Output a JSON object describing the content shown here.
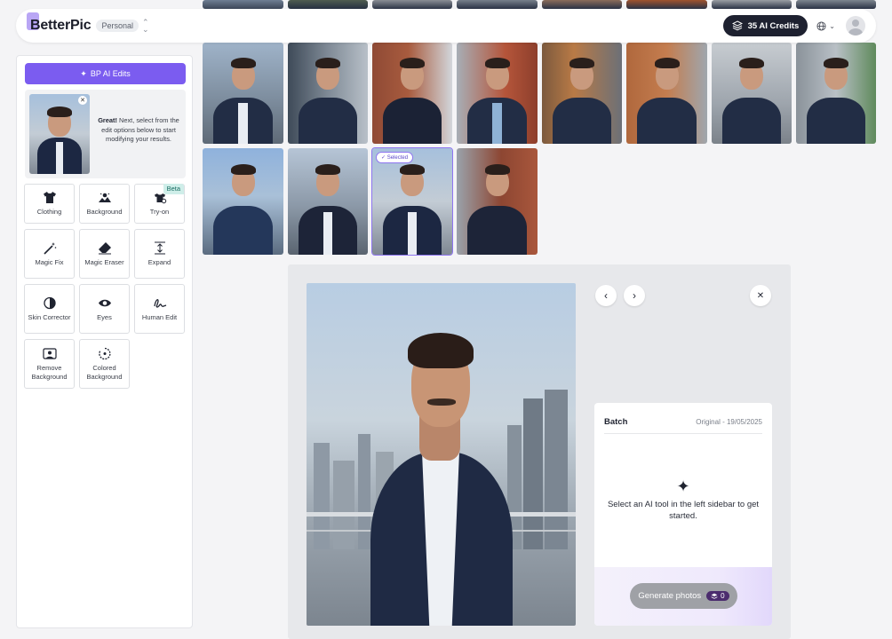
{
  "topbar": {
    "logo_text": "BetterPic",
    "workspace": "Personal",
    "credits_label": "35 AI Credits"
  },
  "sidebar": {
    "ai_edits_label": "BP AI Edits",
    "preview_bold": "Great!",
    "preview_text": " Next, select from the edit options below to start modifying your results.",
    "tools": [
      {
        "label": "Clothing",
        "icon": "tshirt-icon"
      },
      {
        "label": "Background",
        "icon": "landscape-icon"
      },
      {
        "label": "Try-on",
        "icon": "hanger-icon",
        "badge": "Beta"
      },
      {
        "label": "Magic Fix",
        "icon": "magic-wand-icon"
      },
      {
        "label": "Magic Eraser",
        "icon": "eraser-icon"
      },
      {
        "label": "Expand",
        "icon": "expand-icon"
      },
      {
        "label": "Skin Corrector",
        "icon": "contrast-icon"
      },
      {
        "label": "Eyes",
        "icon": "eye-icon"
      },
      {
        "label": "Human Edit",
        "icon": "signature-icon"
      },
      {
        "label": "Remove Background",
        "icon": "remove-bg-icon"
      },
      {
        "label": "Colored Background",
        "icon": "colored-bg-icon"
      }
    ]
  },
  "gallery": {
    "selected_label": "Selected"
  },
  "detail": {
    "batch_title": "Batch",
    "batch_meta": "Original - 19/05/2025",
    "message": "Select an AI tool in the left sidebar to get started.",
    "generate_label": "Generate photos",
    "generate_cost": "0"
  }
}
